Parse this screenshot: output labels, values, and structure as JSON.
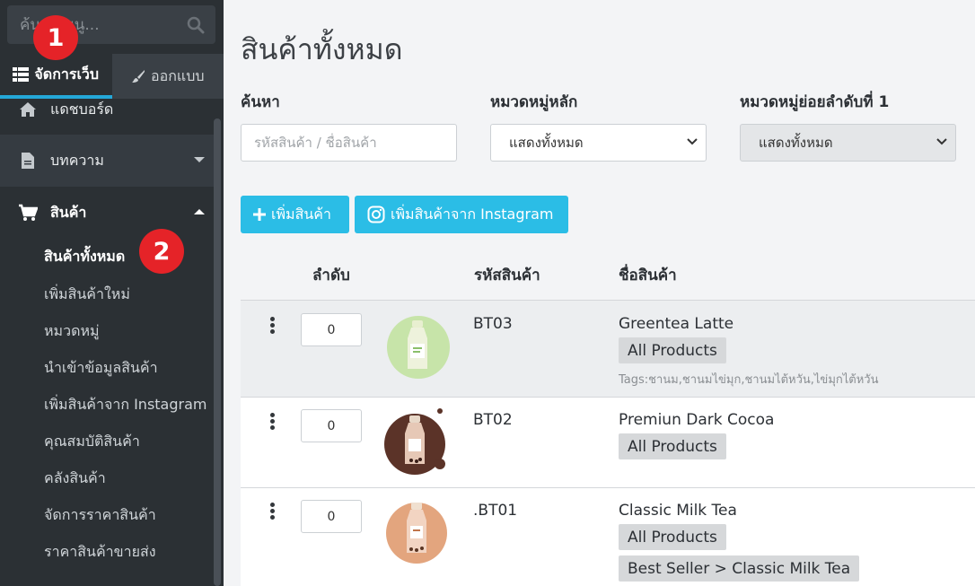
{
  "sidebar": {
    "search_placeholder": "ค้นหาเมนู...",
    "badge1": "1",
    "badge2": "2",
    "tabs": [
      {
        "label": "จัดการเว็บ",
        "icon": "table-icon",
        "active": true
      },
      {
        "label": "ออกแบบ",
        "icon": "paint-brush-icon",
        "active": false
      }
    ],
    "nav": {
      "dashboard": "แดชบอร์ด",
      "article": "บทความ",
      "product": "สินค้า"
    },
    "sub_items": [
      "สินค้าทั้งหมด",
      "เพิ่มสินค้าใหม่",
      "หมวดหมู่",
      "นำเข้าข้อมูลสินค้า",
      "เพิ่มสินค้าจาก Instagram",
      "คุณสมบัติสินค้า",
      "คลังสินค้า",
      "จัดการราคาสินค้า",
      "ราคาสินค้าขายส่ง"
    ]
  },
  "main": {
    "title": "สินค้าทั้งหมด",
    "filters": {
      "search_label": "ค้นหา",
      "search_placeholder": "รหัสสินค้า / ชื่อสินค้า",
      "category_label": "หมวดหมู่หลัก",
      "category_value": "แสดงทั้งหมด",
      "subcategory_label": "หมวดหมู่ย่อยลำดับที่ 1",
      "subcategory_value": "แสดงทั้งหมด"
    },
    "buttons": {
      "add_product": "เพิ่มสินค้า",
      "add_from_instagram": "เพิ่มสินค้าจาก Instagram"
    },
    "table": {
      "headers": [
        "ลำดับ",
        "รหัสสินค้า",
        "ชื่อสินค้า"
      ],
      "rows": [
        {
          "order": "0",
          "code": "BT03",
          "name": "Greentea Latte",
          "categories": [
            "All Products"
          ],
          "tags": "Tags:ชานม,ชานมไข่มุก,ชานมไต้หวัน,ไข่มุกไต้หวัน",
          "image": "green-tea-bottle"
        },
        {
          "order": "0",
          "code": "BT02",
          "name": "Premiun Dark Cocoa",
          "categories": [
            "All Products"
          ],
          "tags": "",
          "image": "cocoa-bottle"
        },
        {
          "order": "0",
          "code": ".BT01",
          "name": "Classic Milk Tea",
          "categories": [
            "All Products",
            "Best Seller > Classic Milk Tea"
          ],
          "tags": "",
          "image": "milk-tea-bottle"
        }
      ]
    }
  },
  "colors": {
    "sidebar_bg": "#2b3034",
    "accent": "#2bbde6",
    "badge_red": "#e52328",
    "active_tab_underline": "#24a8d8"
  }
}
